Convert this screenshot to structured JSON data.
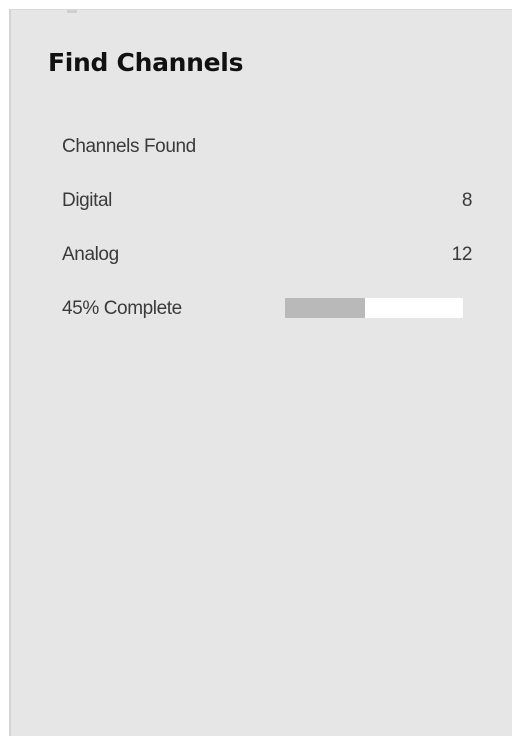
{
  "dialog": {
    "title": "Find Channels",
    "channels_found_label": "Channels Found",
    "rows": [
      {
        "label": "Digital",
        "value": "8"
      },
      {
        "label": "Analog",
        "value": "12"
      }
    ],
    "progress": {
      "label": "45% Complete",
      "percent": 45
    }
  },
  "colors": {
    "panel_background": "#e6e6e6",
    "progress_fill": "#b9b9b9",
    "progress_track": "#ffffff",
    "title_text": "#111111",
    "body_text": "#3a3a3a"
  }
}
